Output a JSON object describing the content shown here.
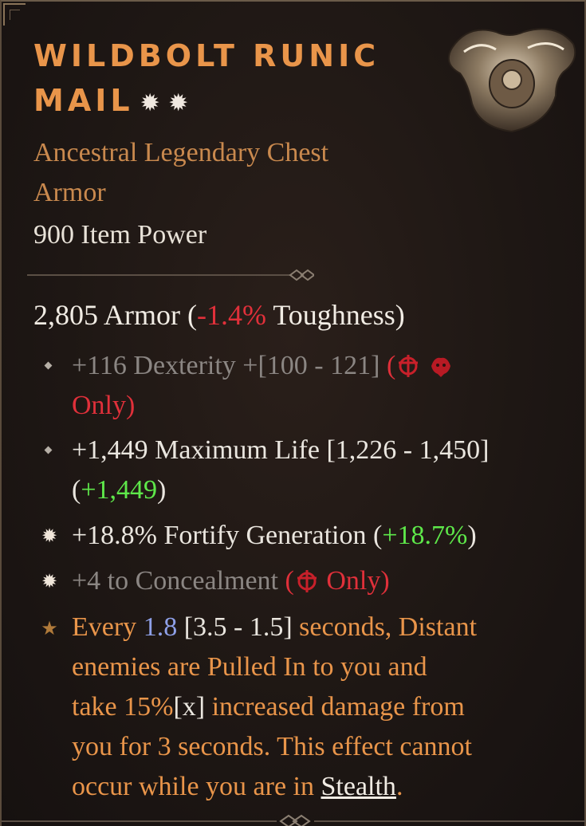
{
  "item": {
    "name_line1": "WILDBOLT RUNIC",
    "name_line2": "MAIL",
    "name_stars": "✹ ✹",
    "type_line1": "Ancestral Legendary Chest",
    "type_line2": "Armor",
    "item_power": "900 Item Power"
  },
  "armor": {
    "value": "2,805 Armor (",
    "toughness_delta": "-1.4%",
    "toughness_label": " Toughness)"
  },
  "affixes": [
    {
      "text": "+116 Dexterity +[100 - 121] ",
      "open_paren": "(",
      "restriction": "Only)",
      "icons": [
        "rogue-class-icon",
        "druid-class-icon"
      ],
      "bullet": "diamond"
    },
    {
      "text": "+1,449 Maximum Life [1,226 - 1,450]",
      "open_paren": "(",
      "delta": "+1,449",
      "close_paren": ")",
      "bullet": "diamond"
    },
    {
      "text": "+18.8% Fortify Generation ",
      "open_paren": "(",
      "delta": "+18.7%",
      "close_paren": ")",
      "bullet": "star-burst"
    },
    {
      "text": "+4 to Concealment ",
      "open_paren": "(",
      "restriction": " Only)",
      "icons": [
        "rogue-class-icon"
      ],
      "bullet": "star-burst"
    }
  ],
  "legendary": {
    "bullet": "★",
    "prefix": "Every ",
    "value": "1.8",
    "range": " [3.5 - 1.5] ",
    "line1_rest": "seconds, Distant",
    "line2": "enemies are Pulled In to you and",
    "line3_a": "take 15%",
    "line3_b": "[x]",
    "line3_c": " increased damage from",
    "line4": "you for 3 seconds. This effect cannot",
    "line5_a": "occur while you are in ",
    "keyword": "Stealth",
    "line5_end": "."
  },
  "colors": {
    "legendary_orange": "#e9954a",
    "negative_red": "#e0303a",
    "positive_green": "#5ee84a",
    "value_blue": "#8ea0e8"
  }
}
